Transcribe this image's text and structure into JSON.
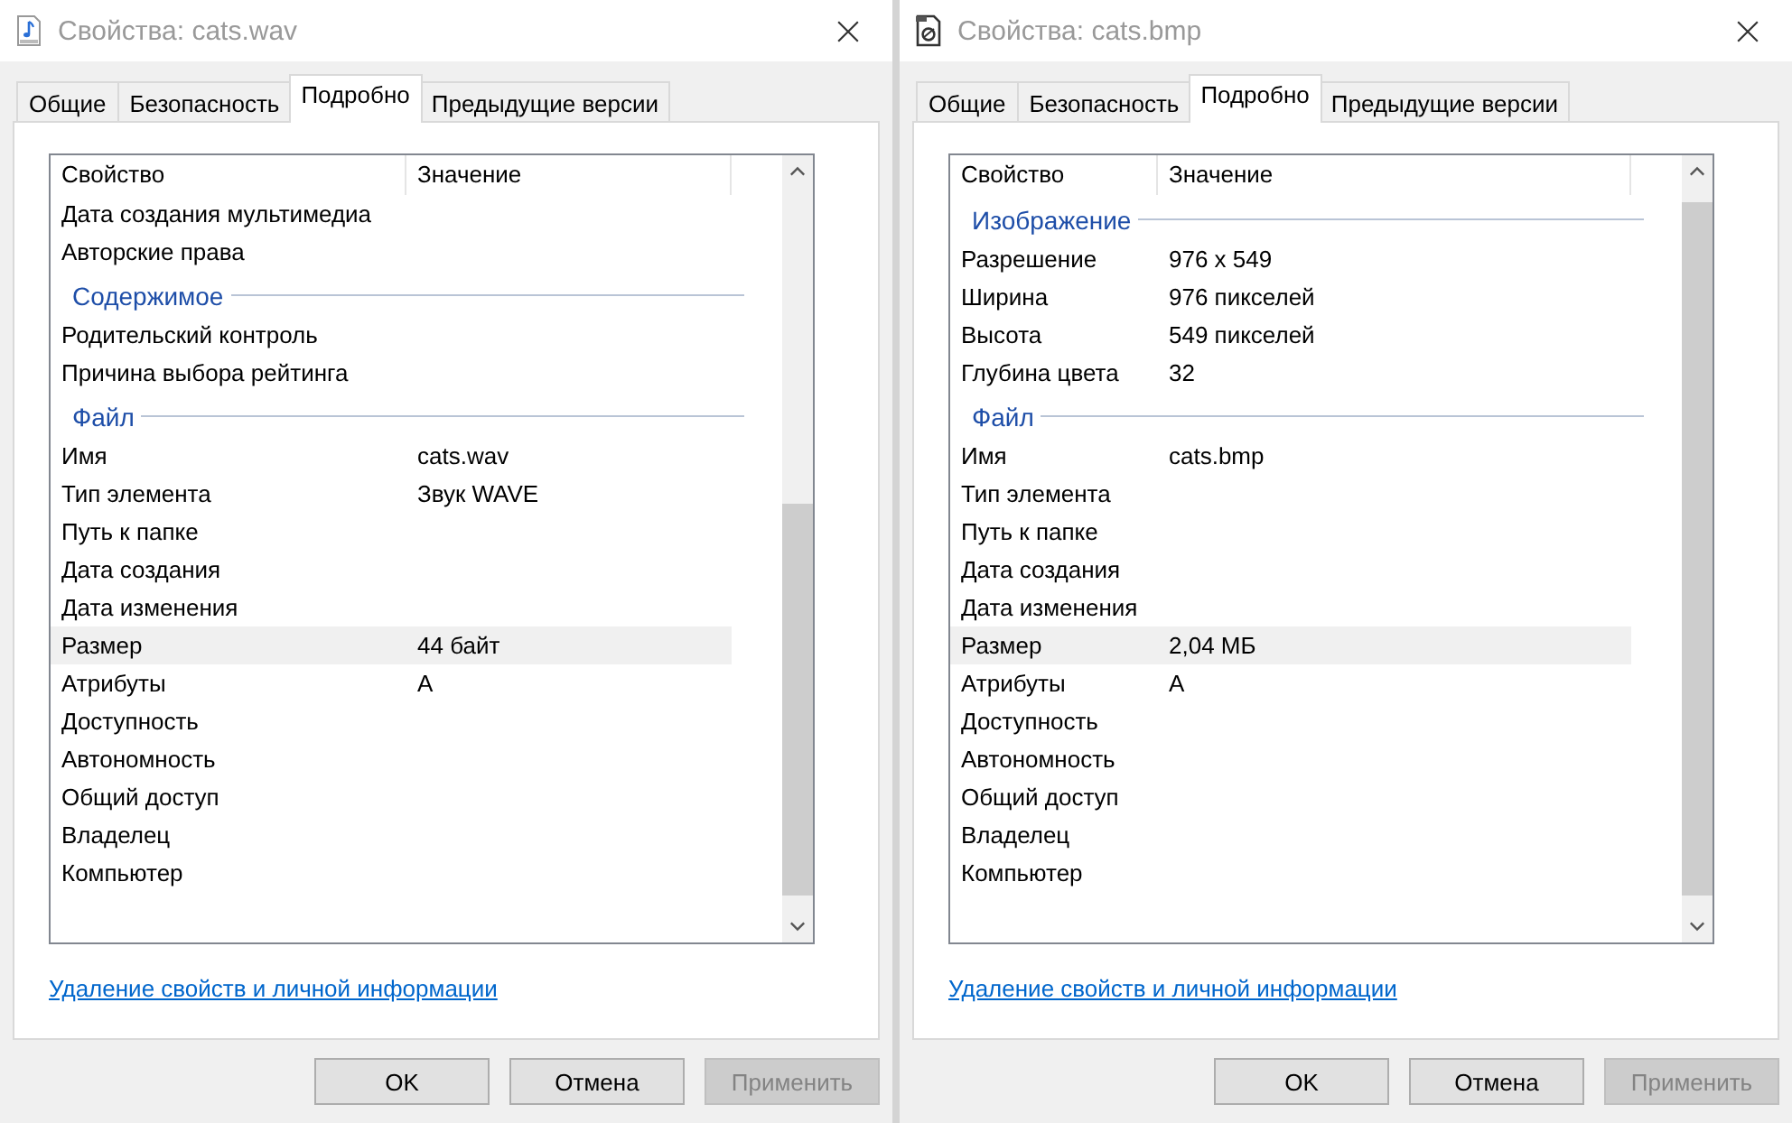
{
  "dialogs": [
    {
      "title": "Свойства: cats.wav",
      "kind": "audio",
      "tabs": [
        {
          "label": "Общие",
          "selected": false
        },
        {
          "label": "Безопасность",
          "selected": false
        },
        {
          "label": "Подробно",
          "selected": true
        },
        {
          "label": "Предыдущие версии",
          "selected": false
        }
      ],
      "columns": [
        "Свойство",
        "Значение"
      ],
      "rows": [
        {
          "kind": "property",
          "name": "Дата создания мультимедиа",
          "selected": false
        },
        {
          "kind": "property",
          "name": "Авторские права",
          "selected": false
        },
        {
          "kind": "group",
          "name": "Содержимое"
        },
        {
          "kind": "property",
          "name": "Родительский контроль",
          "selected": false
        },
        {
          "kind": "property",
          "name": "Причина выбора рейтинга",
          "selected": false
        },
        {
          "kind": "group",
          "name": "Файл"
        },
        {
          "kind": "property",
          "name": "Имя",
          "value": "cats.wav",
          "selected": false
        },
        {
          "kind": "property",
          "name": "Тип элемента",
          "value": "Звук WAVE",
          "selected": false
        },
        {
          "kind": "property",
          "name": "Путь к папке",
          "selected": false
        },
        {
          "kind": "property",
          "name": "Дата создания",
          "selected": false
        },
        {
          "kind": "property",
          "name": "Дата изменения",
          "selected": false
        },
        {
          "kind": "property",
          "name": "Размер",
          "value": "44 байт",
          "selected": true
        },
        {
          "kind": "property",
          "name": "Атрибуты",
          "value": "A",
          "selected": false
        },
        {
          "kind": "property",
          "name": "Доступность",
          "selected": false
        },
        {
          "kind": "property",
          "name": "Автономность",
          "selected": false
        },
        {
          "kind": "property",
          "name": "Общий доступ",
          "selected": false
        },
        {
          "kind": "property",
          "name": "Владелец",
          "selected": false
        },
        {
          "kind": "property",
          "name": "Компьютер",
          "selected": false
        }
      ],
      "link": "Удаление свойств и личной информации",
      "buttons": [
        {
          "label": "OK",
          "disabled": false
        },
        {
          "label": "Отмена",
          "disabled": false
        },
        {
          "label": "Применить",
          "disabled": true
        }
      ]
    },
    {
      "title": "Свойства: cats.bmp",
      "kind": "image",
      "tabs": [
        {
          "label": "Общие",
          "selected": false
        },
        {
          "label": "Безопасность",
          "selected": false
        },
        {
          "label": "Подробно",
          "selected": true
        },
        {
          "label": "Предыдущие версии",
          "selected": false
        }
      ],
      "columns": [
        "Свойство",
        "Значение"
      ],
      "rows": [
        {
          "kind": "group",
          "name": "Изображение"
        },
        {
          "kind": "property",
          "name": "Разрешение",
          "value": "976 x 549",
          "selected": false
        },
        {
          "kind": "property",
          "name": "Ширина",
          "value": "976 пикселей",
          "selected": false
        },
        {
          "kind": "property",
          "name": "Высота",
          "value": "549 пикселей",
          "selected": false
        },
        {
          "kind": "property",
          "name": "Глубина цвета",
          "value": "32",
          "selected": false
        },
        {
          "kind": "group",
          "name": "Файл"
        },
        {
          "kind": "property",
          "name": "Имя",
          "value": "cats.bmp",
          "selected": false
        },
        {
          "kind": "property",
          "name": "Тип элемента",
          "selected": false
        },
        {
          "kind": "property",
          "name": "Путь к папке",
          "selected": false
        },
        {
          "kind": "property",
          "name": "Дата создания",
          "selected": false
        },
        {
          "kind": "property",
          "name": "Дата изменения",
          "selected": false
        },
        {
          "kind": "property",
          "name": "Размер",
          "value": "2,04 МБ",
          "selected": true
        },
        {
          "kind": "property",
          "name": "Атрибуты",
          "value": "A",
          "selected": false
        },
        {
          "kind": "property",
          "name": "Доступность",
          "selected": false
        },
        {
          "kind": "property",
          "name": "Автономность",
          "selected": false
        },
        {
          "kind": "property",
          "name": "Общий доступ",
          "selected": false
        },
        {
          "kind": "property",
          "name": "Владелец",
          "selected": false
        },
        {
          "kind": "property",
          "name": "Компьютер",
          "selected": false
        }
      ],
      "link": "Удаление свойств и личной информации",
      "buttons": [
        {
          "label": "OK",
          "disabled": false
        },
        {
          "label": "Отмена",
          "disabled": false
        },
        {
          "label": "Применить",
          "disabled": true
        }
      ]
    }
  ]
}
